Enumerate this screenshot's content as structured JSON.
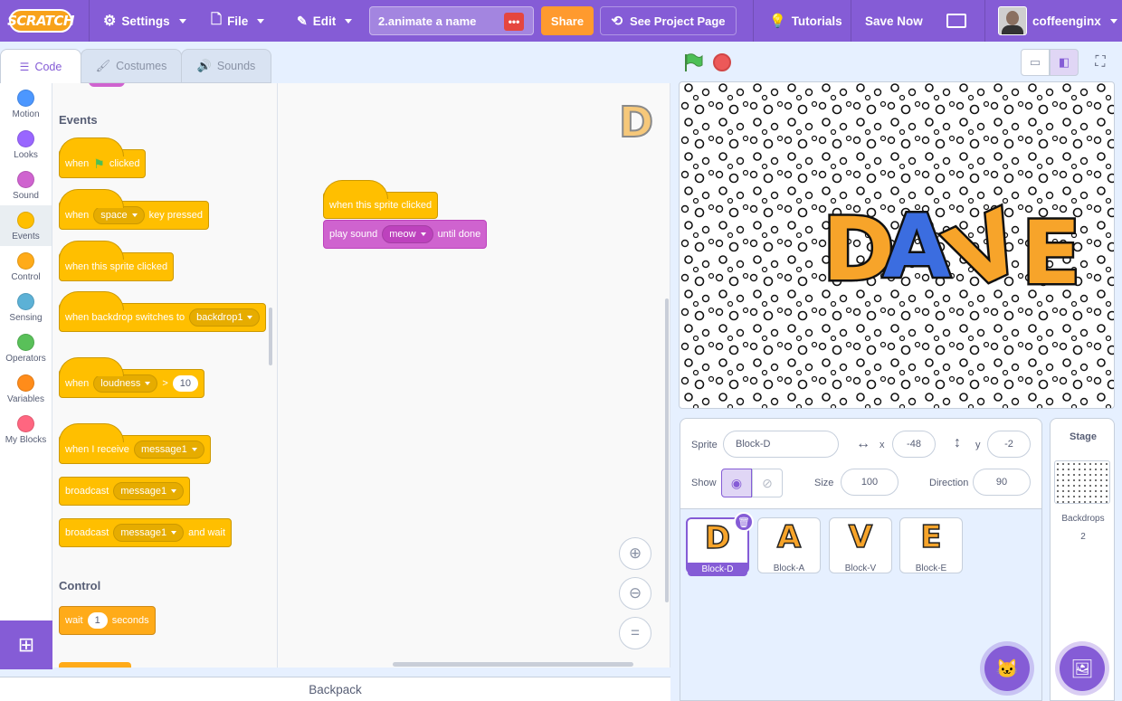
{
  "menubar": {
    "logo": "SCRATCH",
    "settings": "Settings",
    "file": "File",
    "edit": "Edit",
    "project_title": "2.animate a name",
    "share": "Share",
    "see_project": "See Project Page",
    "tutorials": "Tutorials",
    "save_now": "Save Now",
    "username": "coffeenginx"
  },
  "tabs": {
    "code": "Code",
    "costumes": "Costumes",
    "sounds": "Sounds"
  },
  "categories": [
    {
      "label": "Motion",
      "color": "#4c97ff"
    },
    {
      "label": "Looks",
      "color": "#9966ff"
    },
    {
      "label": "Sound",
      "color": "#cf63cf"
    },
    {
      "label": "Events",
      "color": "#ffbf00"
    },
    {
      "label": "Control",
      "color": "#ffab19"
    },
    {
      "label": "Sensing",
      "color": "#5cb1d6"
    },
    {
      "label": "Operators",
      "color": "#59c059"
    },
    {
      "label": "Variables",
      "color": "#ff8c1a"
    },
    {
      "label": "My Blocks",
      "color": "#ff6680"
    }
  ],
  "palette": {
    "events_header": "Events",
    "control_header": "Control",
    "when_flag": {
      "pre": "when",
      "post": "clicked"
    },
    "when_key": {
      "pre": "when",
      "key": "space",
      "post": "key pressed"
    },
    "when_sprite_clicked": "when this sprite clicked",
    "when_backdrop": {
      "pre": "when backdrop switches to",
      "value": "backdrop1"
    },
    "when_loudness": {
      "pre": "when",
      "sensor": "loudness",
      "op": ">",
      "value": "10"
    },
    "when_receive": {
      "pre": "when I receive",
      "value": "message1"
    },
    "broadcast": {
      "pre": "broadcast",
      "value": "message1"
    },
    "broadcast_wait": {
      "pre": "broadcast",
      "value": "message1",
      "post": "and wait"
    },
    "wait": {
      "pre": "wait",
      "value": "1",
      "post": "seconds"
    }
  },
  "script": {
    "hat": "when this sprite clicked",
    "sound_block": {
      "pre": "play sound",
      "value": "meow",
      "post": "until done"
    }
  },
  "backpack": "Backpack",
  "stage": {
    "letters": [
      "D",
      "A",
      "V",
      "E"
    ]
  },
  "sprite_info": {
    "sprite_label": "Sprite",
    "sprite_name": "Block-D",
    "x_label": "x",
    "x_value": "-48",
    "y_label": "y",
    "y_value": "-2",
    "show_label": "Show",
    "size_label": "Size",
    "size_value": "100",
    "direction_label": "Direction",
    "direction_value": "90"
  },
  "sprites": [
    {
      "name": "Block-D",
      "glyph": "D",
      "selected": true
    },
    {
      "name": "Block-A",
      "glyph": "A",
      "selected": false
    },
    {
      "name": "Block-V",
      "glyph": "V",
      "selected": false
    },
    {
      "name": "Block-E",
      "glyph": "E",
      "selected": false
    }
  ],
  "stage_target": {
    "title": "Stage",
    "backdrops_label": "Backdrops",
    "backdrops_count": "2"
  }
}
